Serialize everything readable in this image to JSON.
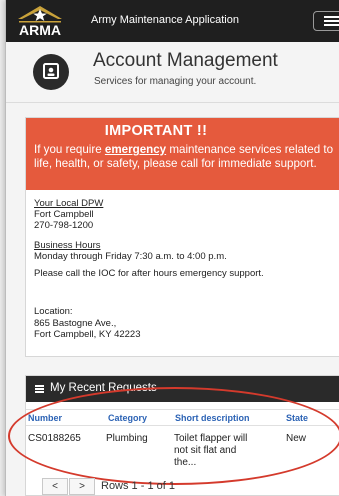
{
  "header": {
    "logo_text": "ARMA",
    "app_title": "Army Maintenance Application",
    "menu_icon": "hamburger-icon"
  },
  "account": {
    "icon": "id-card-icon",
    "title": "Account Management",
    "subtitle": "Services for managing your account."
  },
  "important": {
    "title": "IMPORTANT !!",
    "body_prefix": "If you require ",
    "body_emphasis": "emergency",
    "body_suffix": " maintenance services related to life, health, or safety, please call for immediate support.",
    "local_dpw_label": "Your Local DPW",
    "local_dpw_name": "Fort Campbell",
    "local_dpw_phone": "270-798-1200",
    "hours_label": "Business Hours",
    "hours_value": "Monday through Friday 7:30 a.m. to 4:00 p.m.",
    "after_hours_note": "Please call the IOC for after hours emergency support.",
    "location_label": "Location:",
    "location_line1": "865 Bastogne Ave.,",
    "location_line2": "Fort Campbell, KY 42223",
    "alert_color": "#e55a3d"
  },
  "requests": {
    "title": "My Recent Requests",
    "columns": [
      "Number",
      "Category",
      "Short description",
      "State"
    ],
    "rows": [
      {
        "number": "CS0188265",
        "category": "Plumbing",
        "short_description_l1": "Toilet flapper will",
        "short_description_l2": "not sit flat and",
        "short_description_l3": "the...",
        "state": "New"
      }
    ],
    "pager": {
      "prev": "<",
      "next": ">",
      "rows_text": "Rows 1 - 1 of 1"
    }
  }
}
